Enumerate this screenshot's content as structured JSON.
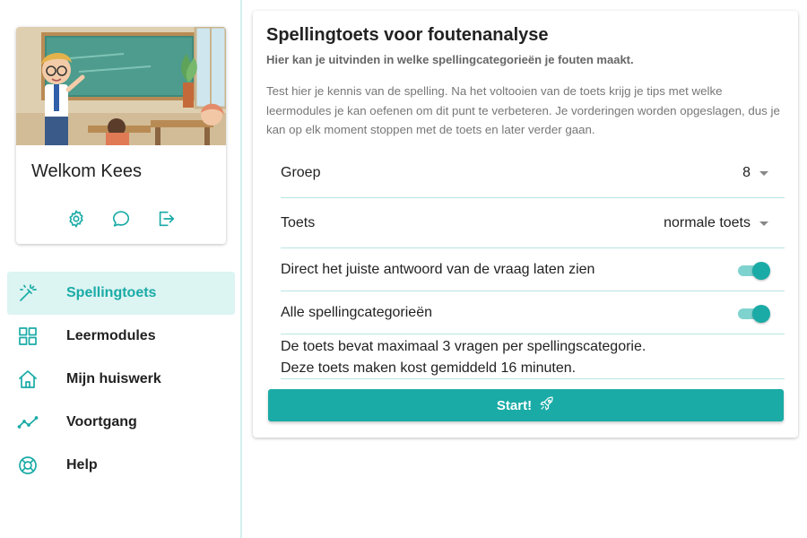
{
  "user": {
    "welcome": "Welkom Kees"
  },
  "profile_actions": [
    {
      "icon": "gear-icon"
    },
    {
      "icon": "chat-icon"
    },
    {
      "icon": "logout-icon"
    }
  ],
  "nav": {
    "items": [
      {
        "label": "Spellingtoets",
        "icon": "magic-wand-icon",
        "active": true
      },
      {
        "label": "Leermodules",
        "icon": "grid-icon",
        "active": false
      },
      {
        "label": "Mijn huiswerk",
        "icon": "home-icon",
        "active": false
      },
      {
        "label": "Voortgang",
        "icon": "trend-icon",
        "active": false
      },
      {
        "label": "Help",
        "icon": "lifebuoy-icon",
        "active": false
      }
    ]
  },
  "main": {
    "title": "Spellingtoets voor foutenanalyse",
    "subtitle": "Hier kan je uitvinden in welke spellingcategorieën je fouten maakt.",
    "intro": "Test hier je kennis van de spelling. Na het voltooien van de toets krijg je tips met welke leermodules je kan oefenen om dit punt te verbeteren. Je vorderingen worden opgeslagen, dus je kan op elk moment stoppen met de toets en later verder gaan.",
    "groep": {
      "label": "Groep",
      "value": "8"
    },
    "toets": {
      "label": "Toets",
      "value": "normale toets"
    },
    "toggle_answer": {
      "label": "Direct het juiste antwoord van de vraag laten zien",
      "on": true
    },
    "toggle_categories": {
      "label": "Alle spellingcategorieën",
      "on": true
    },
    "info_line1": "De toets bevat maximaal 3 vragen per spellingscategorie.",
    "info_line2": "Deze toets maken kost gemiddeld 16 minuten.",
    "start_label": "Start!",
    "start_icon": "rocket-icon"
  },
  "colors": {
    "accent": "#1aaba6",
    "accent_light": "#dcf4f2",
    "toggle_track": "#7fd3cf"
  }
}
